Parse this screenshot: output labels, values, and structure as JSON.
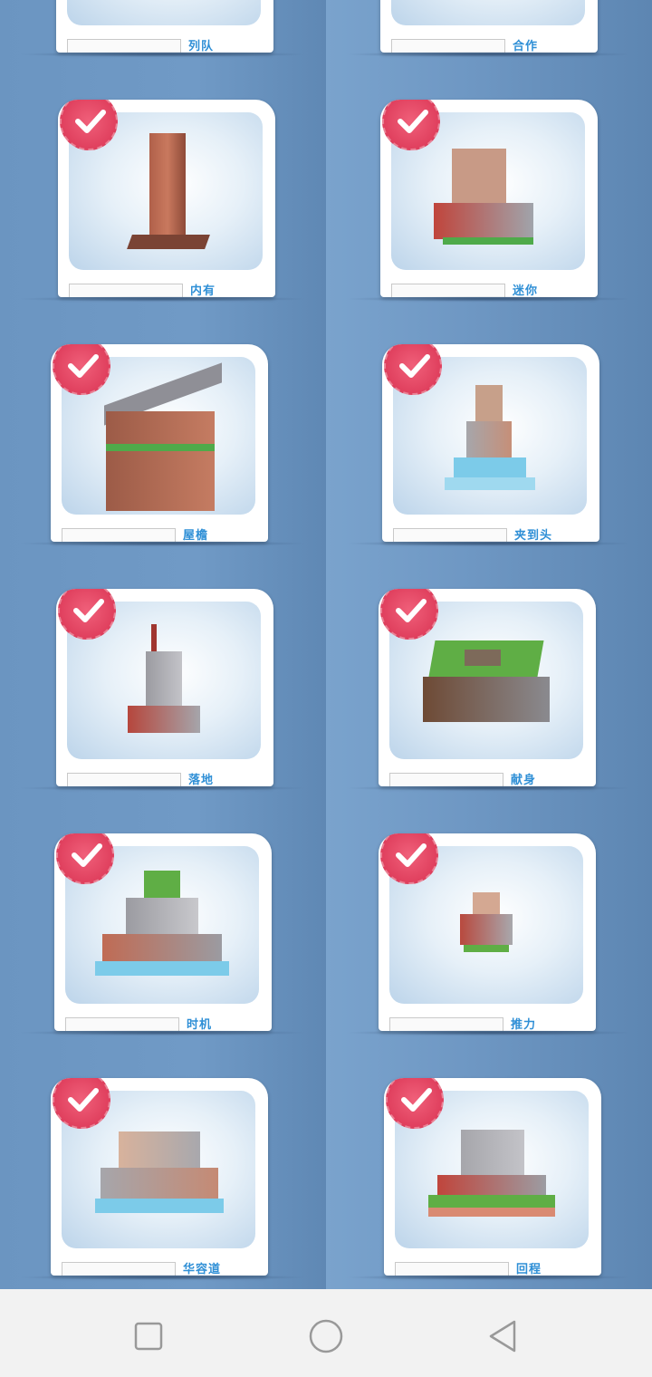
{
  "levels": [
    {
      "title": "列队"
    },
    {
      "title": "合作"
    },
    {
      "title": "内有"
    },
    {
      "title": "迷你"
    },
    {
      "title": "屋檐"
    },
    {
      "title": "夹到头"
    },
    {
      "title": "落地"
    },
    {
      "title": "献身"
    },
    {
      "title": "时机"
    },
    {
      "title": "推力"
    },
    {
      "title": "华容道"
    },
    {
      "title": "回程"
    }
  ],
  "colors": {
    "badge": "#e0405e",
    "title": "#2f8fd6",
    "background": "#6d97c2"
  },
  "navbar": {
    "recent_icon": "square-icon",
    "home_icon": "circle-icon",
    "back_icon": "triangle-back-icon"
  }
}
